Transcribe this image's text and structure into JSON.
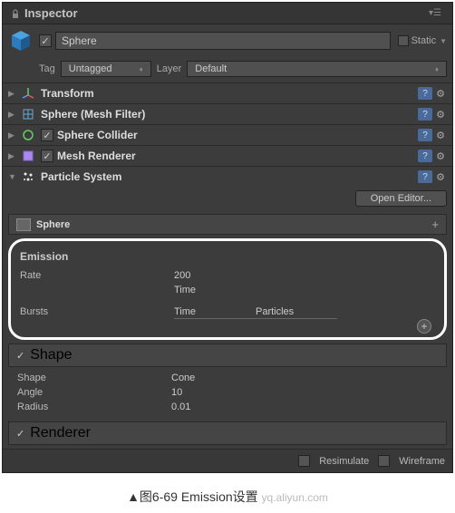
{
  "header": {
    "title": "Inspector"
  },
  "object": {
    "name": "Sphere",
    "static_label": "Static",
    "tag_label": "Tag",
    "tag_value": "Untagged",
    "layer_label": "Layer",
    "layer_value": "Default"
  },
  "components": {
    "transform": "Transform",
    "mesh_filter": "Sphere (Mesh Filter)",
    "sphere_collider": "Sphere Collider",
    "mesh_renderer": "Mesh Renderer",
    "particle_system": "Particle System"
  },
  "open_editor_label": "Open Editor...",
  "module": {
    "title": "Sphere",
    "emission": {
      "title": "Emission",
      "rate_label": "Rate",
      "rate_value": "200",
      "rate_mode": "Time",
      "bursts_label": "Bursts",
      "col_time": "Time",
      "col_particles": "Particles"
    },
    "shape": {
      "title": "Shape",
      "shape_label": "Shape",
      "shape_value": "Cone",
      "angle_label": "Angle",
      "angle_value": "10",
      "radius_label": "Radius",
      "radius_value": "0.01"
    },
    "renderer": {
      "title": "Renderer"
    }
  },
  "footer": {
    "resimulate_label": "Resimulate",
    "wireframe_label": "Wireframe"
  },
  "caption": "▲图6-69 Emission设置",
  "watermark": "yq.aliyun.com"
}
